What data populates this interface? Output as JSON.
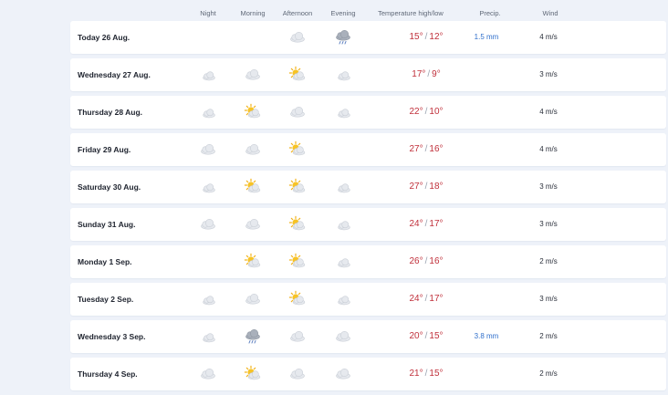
{
  "headers": {
    "night": "Night",
    "morning": "Morning",
    "afternoon": "Afternoon",
    "evening": "Evening",
    "temperature": "Temperature high/low",
    "precip": "Precip.",
    "wind": "Wind"
  },
  "colors": {
    "temperature": "#c0303b",
    "precip": "#2f6fcb",
    "background": "#eef2f9",
    "row": "#ffffff"
  },
  "days": [
    {
      "label": "Today 26 Aug.",
      "night": "",
      "morning": "",
      "afternoon": "cloud",
      "evening": "rain-cloud",
      "high": "15°",
      "low": "12°",
      "precip": "1.5 mm",
      "wind": "4 m/s"
    },
    {
      "label": "Wednesday 27 Aug.",
      "night": "moon-cloud",
      "morning": "cloud",
      "afternoon": "sun-cloud",
      "evening": "moon-cloud",
      "high": "17°",
      "low": "9°",
      "precip": "",
      "wind": "3 m/s"
    },
    {
      "label": "Thursday 28 Aug.",
      "night": "moon-cloud",
      "morning": "sun-cloud",
      "afternoon": "cloud",
      "evening": "moon-cloud",
      "high": "22°",
      "low": "10°",
      "precip": "",
      "wind": "4 m/s"
    },
    {
      "label": "Friday 29 Aug.",
      "night": "cloud",
      "morning": "cloud",
      "afternoon": "sun-cloud",
      "evening": "moon",
      "high": "27°",
      "low": "16°",
      "precip": "",
      "wind": "4 m/s"
    },
    {
      "label": "Saturday 30 Aug.",
      "night": "moon-cloud",
      "morning": "sun-cloud",
      "afternoon": "sun-cloud",
      "evening": "moon-cloud",
      "high": "27°",
      "low": "18°",
      "precip": "",
      "wind": "3 m/s"
    },
    {
      "label": "Sunday 31 Aug.",
      "night": "cloud",
      "morning": "cloud",
      "afternoon": "sun-cloud",
      "evening": "moon-cloud",
      "high": "24°",
      "low": "17°",
      "precip": "",
      "wind": "3 m/s"
    },
    {
      "label": "Monday 1 Sep.",
      "night": "moon",
      "morning": "sun-cloud",
      "afternoon": "sun-cloud",
      "evening": "moon-cloud",
      "high": "26°",
      "low": "16°",
      "precip": "",
      "wind": "2 m/s"
    },
    {
      "label": "Tuesday 2 Sep.",
      "night": "moon-cloud",
      "morning": "cloud",
      "afternoon": "sun-cloud",
      "evening": "moon-cloud",
      "high": "24°",
      "low": "17°",
      "precip": "",
      "wind": "3 m/s"
    },
    {
      "label": "Wednesday 3 Sep.",
      "night": "moon-cloud",
      "morning": "rain-cloud",
      "afternoon": "cloud",
      "evening": "cloud",
      "high": "20°",
      "low": "15°",
      "precip": "3.8 mm",
      "wind": "2 m/s"
    },
    {
      "label": "Thursday 4 Sep.",
      "night": "cloud",
      "morning": "sun-cloud",
      "afternoon": "cloud",
      "evening": "cloud",
      "high": "21°",
      "low": "15°",
      "precip": "",
      "wind": "2 m/s"
    }
  ]
}
